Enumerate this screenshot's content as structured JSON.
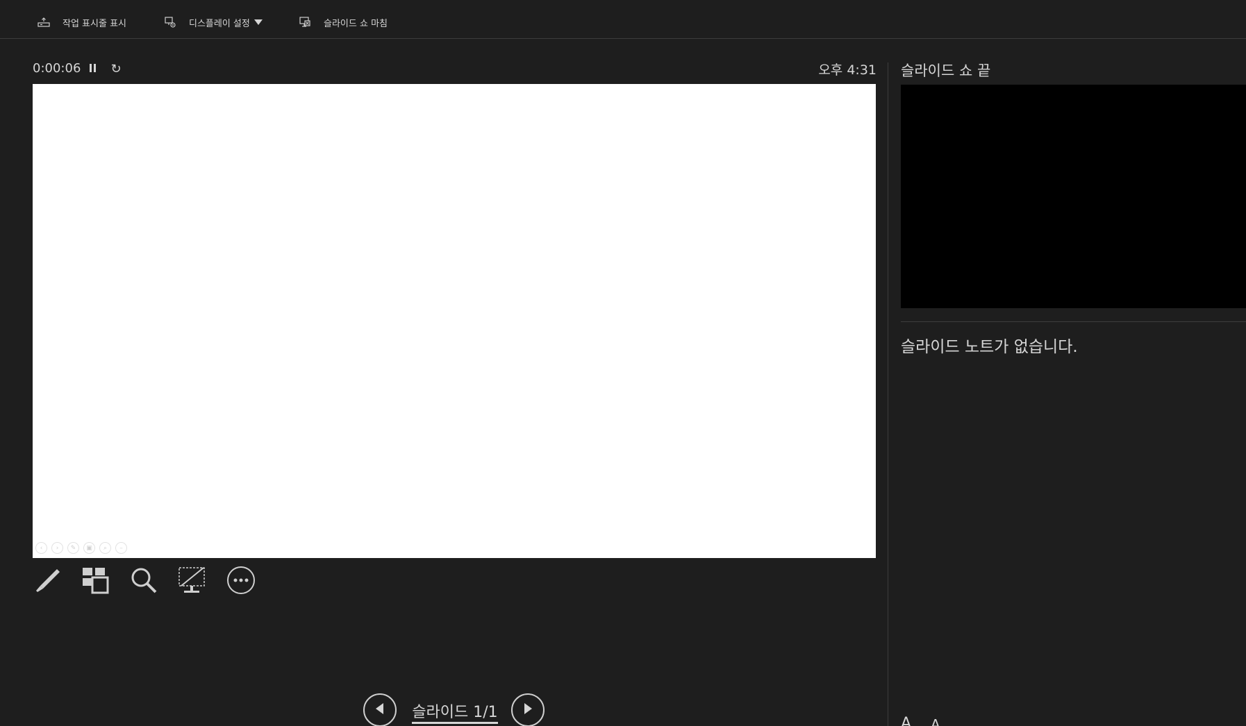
{
  "toolbar": {
    "taskbar_label": "작업 표시줄 표시",
    "display_label": "디스플레이 설정",
    "end_label": "슬라이드 쇼 마침"
  },
  "presenter": {
    "elapsed": "0:00:06",
    "reset_glyph": "↻",
    "clock": "오후 4:31"
  },
  "next_slide": {
    "label": "슬라이드 쇼 끝"
  },
  "notes": {
    "text": "슬라이드 노트가 없습니다."
  },
  "font_size": {
    "increase": "A",
    "decrease": "A"
  },
  "navigation": {
    "counter": "슬라이드 1/1"
  },
  "icons": {
    "taskbar": "taskbar-icon",
    "display": "display-settings-icon",
    "end": "end-show-icon",
    "pause": "pause-icon",
    "reset": "reset-icon",
    "pen": "pen-icon",
    "all_slides": "see-all-slides-icon",
    "zoom": "zoom-icon",
    "black_screen": "black-screen-icon",
    "more": "more-options-icon",
    "prev": "previous-slide-icon",
    "next": "next-slide-icon"
  },
  "colors": {
    "background": "#1e1e1e",
    "text": "#d6d6d6",
    "slide": "#ffffff",
    "next_preview": "#000000"
  }
}
